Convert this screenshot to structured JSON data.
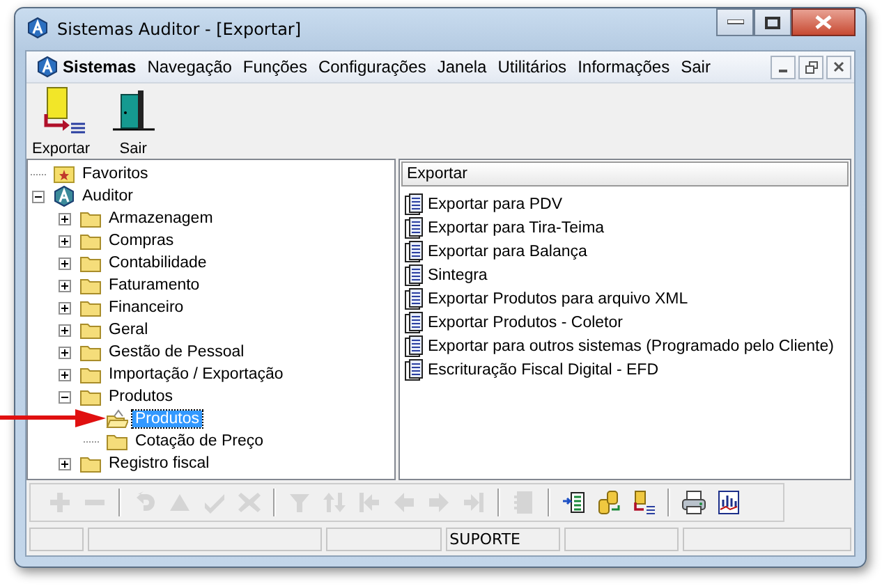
{
  "window": {
    "title": "Sistemas Auditor - [Exportar]"
  },
  "menu": [
    {
      "label": "Sistemas",
      "kind": "app"
    },
    {
      "label": "Navegação",
      "kind": "plain"
    },
    {
      "label": "Funções",
      "kind": "plain"
    },
    {
      "label": "Configurações",
      "kind": "plain"
    },
    {
      "label": "Janela",
      "kind": "plain"
    },
    {
      "label": "Utilitários",
      "kind": "plain"
    },
    {
      "label": "Informações",
      "kind": "plain"
    },
    {
      "label": "Sair",
      "kind": "plain"
    }
  ],
  "toolbar": [
    {
      "label": "Exportar",
      "kind": "export"
    },
    {
      "label": "Sair",
      "kind": "door"
    }
  ],
  "tree": [
    {
      "label": "Favoritos",
      "kind": "favorite",
      "selected": false
    },
    {
      "label": "Auditor",
      "kind": "app",
      "expanded": true,
      "selected": false,
      "children": [
        {
          "label": "Armazenagem",
          "kind": "folder",
          "expanded": false,
          "selected": false
        },
        {
          "label": "Compras",
          "kind": "folder",
          "expanded": false,
          "selected": false
        },
        {
          "label": "Contabilidade",
          "kind": "folder",
          "expanded": false,
          "selected": false
        },
        {
          "label": "Faturamento",
          "kind": "folder",
          "expanded": false,
          "selected": false
        },
        {
          "label": "Financeiro",
          "kind": "folder",
          "expanded": false,
          "selected": false
        },
        {
          "label": "Geral",
          "kind": "folder",
          "expanded": false,
          "selected": false
        },
        {
          "label": "Gestão de Pessoal",
          "kind": "folder",
          "expanded": false,
          "selected": false
        },
        {
          "label": "Importação / Exportação",
          "kind": "folder",
          "expanded": false,
          "selected": false
        },
        {
          "label": "Produtos",
          "kind": "folder",
          "expanded": true,
          "selected": false,
          "children": [
            {
              "label": "Produtos",
              "kind": "open-folder",
              "selected": true
            },
            {
              "label": "Cotação de Preço",
              "kind": "folder",
              "selected": false
            }
          ]
        },
        {
          "label": "Registro fiscal",
          "kind": "folder",
          "expanded": false,
          "selected": false
        }
      ]
    }
  ],
  "list": {
    "header": "Exportar",
    "items": [
      "Exportar para PDV",
      "Exportar para Tira-Teima",
      "Exportar para Balança",
      "Sintegra",
      "Exportar Produtos para arquivo XML",
      "Exportar Produtos - Coletor",
      "Exportar para outros sistemas (Programado pelo Cliente)",
      "Escrituração Fiscal Digital - EFD"
    ]
  },
  "bottom_toolbar": [
    {
      "kind": "plus",
      "disabled": true
    },
    {
      "kind": "minus",
      "disabled": true
    },
    {
      "kind": "sep"
    },
    {
      "kind": "refresh",
      "disabled": true
    },
    {
      "kind": "up",
      "disabled": true
    },
    {
      "kind": "check",
      "disabled": true
    },
    {
      "kind": "cross",
      "disabled": true
    },
    {
      "kind": "sep"
    },
    {
      "kind": "filter",
      "disabled": true
    },
    {
      "kind": "sort",
      "disabled": true
    },
    {
      "kind": "first",
      "disabled": true
    },
    {
      "kind": "prev",
      "disabled": true
    },
    {
      "kind": "next",
      "disabled": true
    },
    {
      "kind": "last",
      "disabled": true
    },
    {
      "kind": "sep"
    },
    {
      "kind": "doc",
      "disabled": true
    },
    {
      "kind": "sep"
    },
    {
      "kind": "list",
      "disabled": false
    },
    {
      "kind": "swap",
      "disabled": false
    },
    {
      "kind": "export",
      "disabled": false
    },
    {
      "kind": "sep"
    },
    {
      "kind": "print",
      "disabled": false
    },
    {
      "kind": "chart",
      "disabled": false
    }
  ],
  "status_bar": {
    "user": "SUPORTE"
  }
}
